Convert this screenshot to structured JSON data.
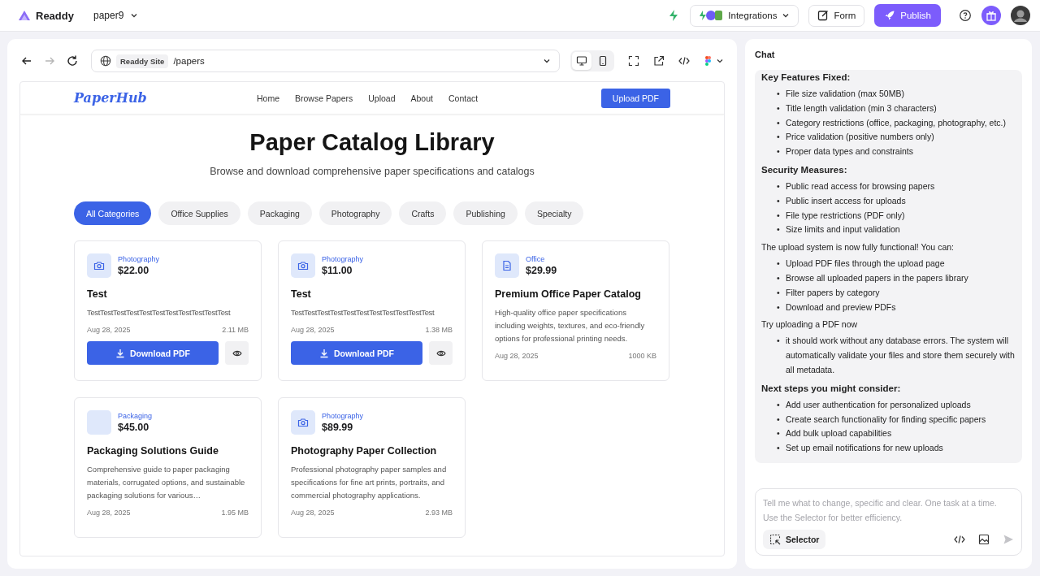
{
  "topbar": {
    "brand": "Readdy",
    "project": "paper9",
    "integrations": "Integrations",
    "form": "Form",
    "publish": "Publish"
  },
  "browser": {
    "forward_disabled": true,
    "site_badge": "Readdy Site",
    "path": "/papers",
    "devices": [
      {
        "kind": "desktop",
        "selected": true
      },
      {
        "kind": "mobile",
        "selected": false
      }
    ]
  },
  "site": {
    "logo": "PaperHub",
    "nav": [
      "Home",
      "Browse Papers",
      "Upload",
      "About",
      "Contact"
    ],
    "cta": "Upload PDF",
    "title": "Paper Catalog Library",
    "subtitle": "Browse and download comprehensive paper specifications and catalogs",
    "filters": [
      {
        "label": "All Categories",
        "selected": true
      },
      {
        "label": "Office Supplies",
        "selected": false
      },
      {
        "label": "Packaging",
        "selected": false
      },
      {
        "label": "Photography",
        "selected": false
      },
      {
        "label": "Crafts",
        "selected": false
      },
      {
        "label": "Publishing",
        "selected": false
      },
      {
        "label": "Specialty",
        "selected": false
      }
    ],
    "cards": [
      {
        "kind": "photo",
        "category": "Photography",
        "price": "$22.00",
        "title": "Test",
        "description": "TestTestTestTestTestTestTestTestTestTestTest",
        "date": "Aug 28, 2025",
        "size": "2.11 MB",
        "download": "Download PDF"
      },
      {
        "kind": "photo",
        "category": "Photography",
        "price": "$11.00",
        "title": "Test",
        "description": "TestTestTestTestTestTestTestTestTestTestTest",
        "date": "Aug 28, 2025",
        "size": "1.38 MB",
        "download": "Download PDF"
      },
      {
        "kind": "document",
        "category": "Office",
        "price": "$29.99",
        "title": "Premium Office Paper Catalog",
        "description": "High-quality office paper specifications including weights, textures, and eco-friendly options for professional printing needs.",
        "date": "Aug 28, 2025",
        "size": "1000 KB"
      },
      {
        "kind": "plain",
        "category": "Packaging",
        "price": "$45.00",
        "title": "Packaging Solutions Guide",
        "description": "Comprehensive guide to paper packaging materials, corrugated options, and sustainable packaging solutions for various…",
        "date": "Aug 28, 2025",
        "size": "1.95 MB"
      },
      {
        "kind": "photo",
        "category": "Photography",
        "price": "$89.99",
        "title": "Photography Paper Collection",
        "description": "Professional photography paper samples and specifications for fine art prints, portraits, and commercial photography applications.",
        "date": "Aug 28, 2025",
        "size": "2.93 MB"
      }
    ]
  },
  "chat": {
    "title": "Chat",
    "blocks": [
      {
        "kind": "heading",
        "text": "Key Features Fixed:"
      },
      {
        "kind": "bullets",
        "marker": "•",
        "items": [
          "File size validation (max 50MB)",
          "Title length validation (min 3 characters)",
          "Category restrictions (office, packaging, photography, etc.)",
          "Price validation (positive numbers only)",
          "Proper data types and constraints"
        ]
      },
      {
        "kind": "heading",
        "text": "Security Measures:"
      },
      {
        "kind": "bullets",
        "marker": "•",
        "items": [
          "Public read access for browsing papers",
          "Public insert access for uploads",
          "File type restrictions (PDF only)",
          "Size limits and input validation"
        ]
      },
      {
        "kind": "para",
        "text": "The upload system is now fully functional! You can:"
      },
      {
        "kind": "bullets",
        "marker": "•",
        "items": [
          "Upload PDF files through the upload page",
          "Browse all uploaded papers in the papers library",
          "Filter papers by category",
          "Download and preview PDFs"
        ]
      },
      {
        "kind": "para",
        "text": "Try uploading a PDF now"
      },
      {
        "kind": "bullets",
        "marker": "•",
        "items": [
          "it should work without any database errors. The system will automatically validate your files and store them securely with all metadata."
        ]
      },
      {
        "kind": "heading",
        "text": "Next steps you might consider:"
      },
      {
        "kind": "bullets",
        "marker": "•",
        "items": [
          "Add user authentication for personalized uploads",
          "Create search functionality for finding specific papers",
          "Add bulk upload capabilities",
          "Set up email notifications for new uploads"
        ]
      }
    ],
    "placeholder": "Tell me what to change, specific and clear. One task at a time. Use the Selector for better efficiency.",
    "selector": "Selector"
  }
}
